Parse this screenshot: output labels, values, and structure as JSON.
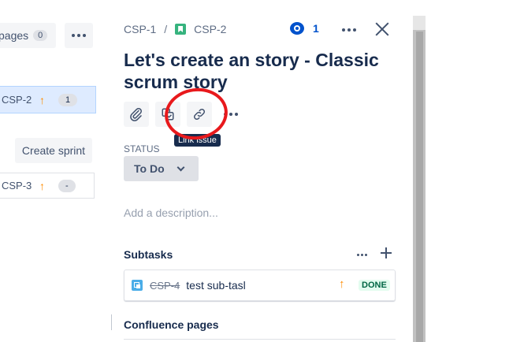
{
  "backlog": {
    "pages_label": "pages",
    "pages_count": "0",
    "rows": [
      {
        "key": "CSP-2",
        "badge": "1"
      },
      {
        "key": "CSP-3",
        "badge": "-"
      }
    ],
    "create_sprint_label": "Create sprint"
  },
  "issue": {
    "breadcrumb_parent": "CSP-1",
    "breadcrumb_separator": "/",
    "breadcrumb_current": "CSP-2",
    "watchers_count": "1",
    "title": "Let's create an story - Classic scrum story",
    "tooltip": "Link issue",
    "status_label": "STATUS",
    "status_value": "To Do",
    "description_placeholder": "Add a description...",
    "subtasks_title": "Subtasks",
    "subtasks": [
      {
        "key": "CSP-4",
        "name": "test sub-tasl",
        "status": "DONE"
      }
    ],
    "confluence_title": "Confluence pages"
  },
  "colors": {
    "accent": "#0052cc",
    "annotation": "#e8191c",
    "story": "#36b37e",
    "priority": "#ff8b00",
    "done": "#006644"
  },
  "icons": [
    "dots-icon",
    "arrow-up-icon",
    "story-icon",
    "eye-icon",
    "close-icon",
    "attachment-icon",
    "subtask-icon",
    "link-icon",
    "chevron-down-icon",
    "plus-icon"
  ]
}
